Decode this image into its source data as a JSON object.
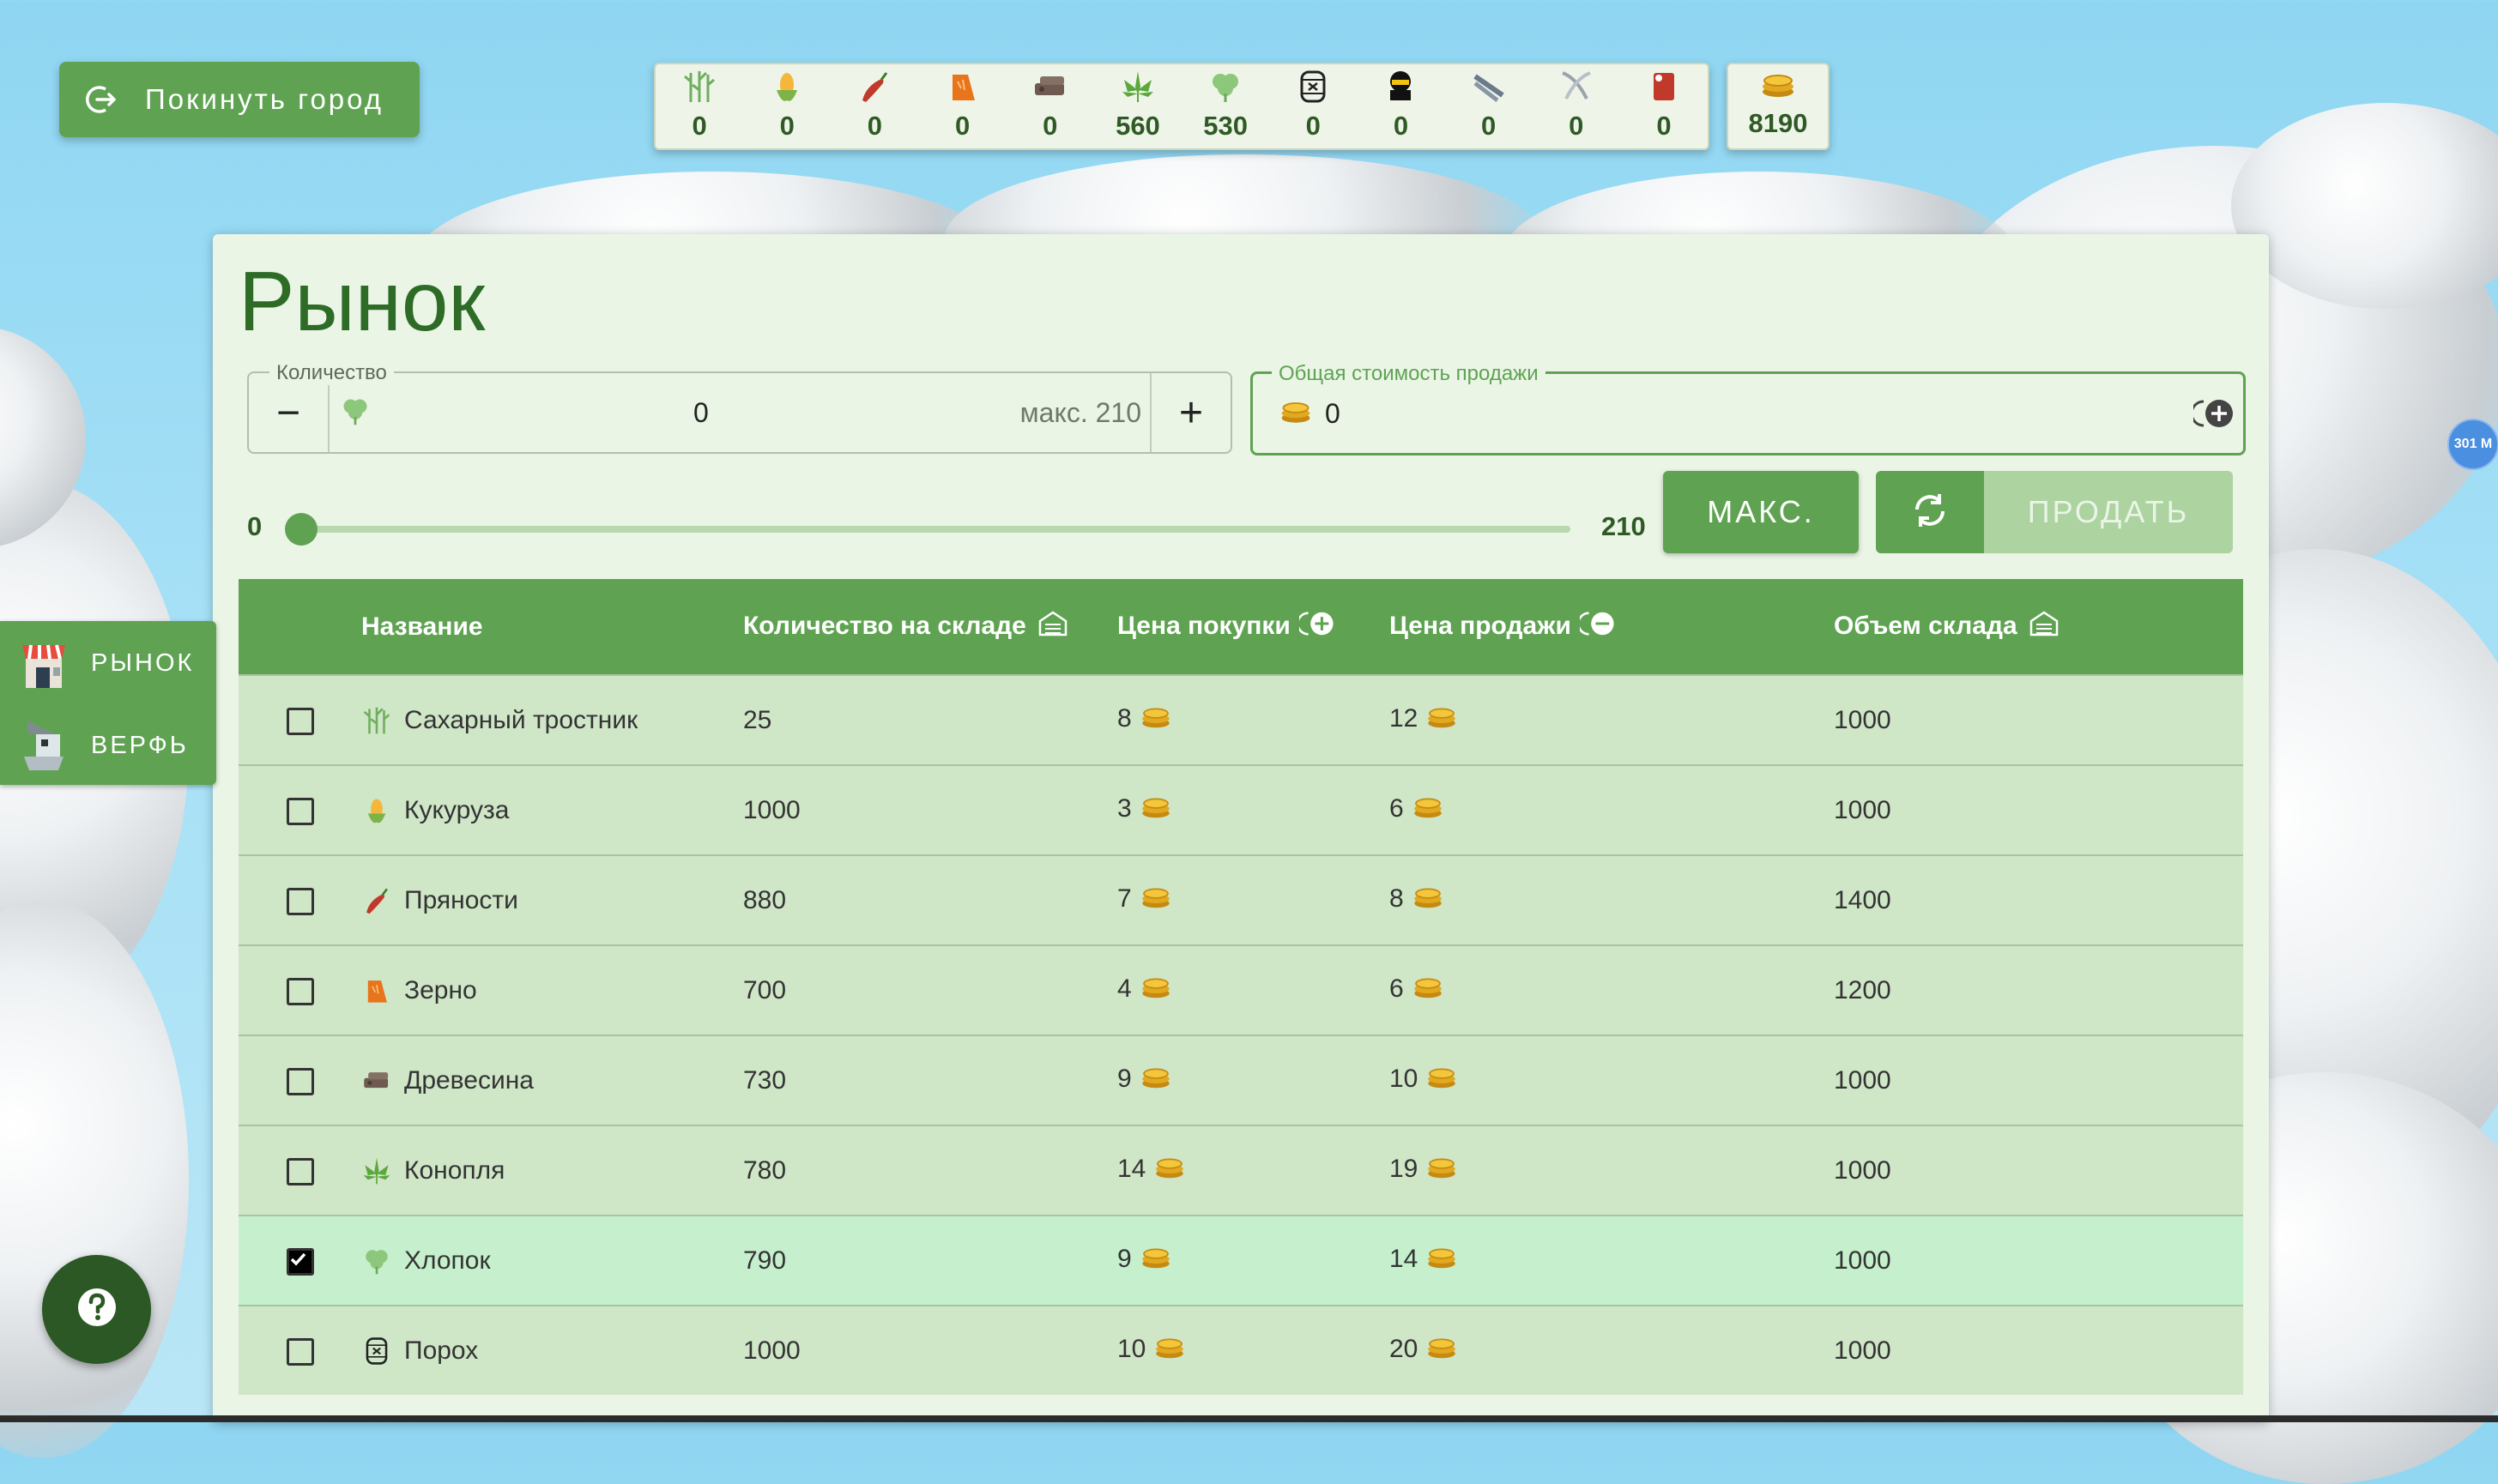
{
  "leave_button": {
    "label": "Покинуть город"
  },
  "resources": [
    {
      "icon": "sugarcane-icon",
      "value": "0"
    },
    {
      "icon": "corn-icon",
      "value": "0"
    },
    {
      "icon": "spice-icon",
      "value": "0"
    },
    {
      "icon": "grain-icon",
      "value": "0"
    },
    {
      "icon": "wood-icon",
      "value": "0"
    },
    {
      "icon": "hemp-icon",
      "value": "560"
    },
    {
      "icon": "cotton-icon",
      "value": "530"
    },
    {
      "icon": "gunpowder-icon",
      "value": "0"
    },
    {
      "icon": "cannonball-icon",
      "value": "0"
    },
    {
      "icon": "iron-bars-icon",
      "value": "0"
    },
    {
      "icon": "swords-icon",
      "value": "0"
    },
    {
      "icon": "cloth-icon",
      "value": "0"
    }
  ],
  "coins": {
    "value": "8190"
  },
  "market": {
    "title": "Рынок",
    "quantity": {
      "legend": "Количество",
      "value": "0",
      "max_label": "макс. 210",
      "minus": "−",
      "plus": "+"
    },
    "total": {
      "legend": "Общая стоимость продажи",
      "value": "0"
    },
    "slider": {
      "min": "0",
      "max": "210",
      "value": 0
    },
    "max_button": "МАКС.",
    "sell_button": "ПРОДАТЬ",
    "columns": {
      "name": "Название",
      "stock": "Количество на складе",
      "buy": "Цена покупки",
      "sell": "Цена продажи",
      "capacity": "Объем склада"
    },
    "rows": [
      {
        "name": "Сахарный тростник",
        "icon": "sugarcane-icon",
        "stock": "25",
        "buy": "8",
        "sell": "12",
        "capacity": "1000",
        "checked": false
      },
      {
        "name": "Кукуруза",
        "icon": "corn-icon",
        "stock": "1000",
        "buy": "3",
        "sell": "6",
        "capacity": "1000",
        "checked": false
      },
      {
        "name": "Пряности",
        "icon": "spice-icon",
        "stock": "880",
        "buy": "7",
        "sell": "8",
        "capacity": "1400",
        "checked": false
      },
      {
        "name": "Зерно",
        "icon": "grain-icon",
        "stock": "700",
        "buy": "4",
        "sell": "6",
        "capacity": "1200",
        "checked": false
      },
      {
        "name": "Древесина",
        "icon": "wood-icon",
        "stock": "730",
        "buy": "9",
        "sell": "10",
        "capacity": "1000",
        "checked": false
      },
      {
        "name": "Конопля",
        "icon": "hemp-icon",
        "stock": "780",
        "buy": "14",
        "sell": "19",
        "capacity": "1000",
        "checked": false
      },
      {
        "name": "Хлопок",
        "icon": "cotton-icon",
        "stock": "790",
        "buy": "9",
        "sell": "14",
        "capacity": "1000",
        "checked": true
      },
      {
        "name": "Порох",
        "icon": "gunpowder-icon",
        "stock": "1000",
        "buy": "10",
        "sell": "20",
        "capacity": "1000",
        "checked": false
      }
    ]
  },
  "side_menu": {
    "market": "РЫНОК",
    "shipyard": "ВЕРФЬ"
  },
  "distance_badge": "301 M",
  "colors": {
    "accent": "#5fa352",
    "dark": "#2b5824",
    "text_green": "#2f5a25"
  }
}
